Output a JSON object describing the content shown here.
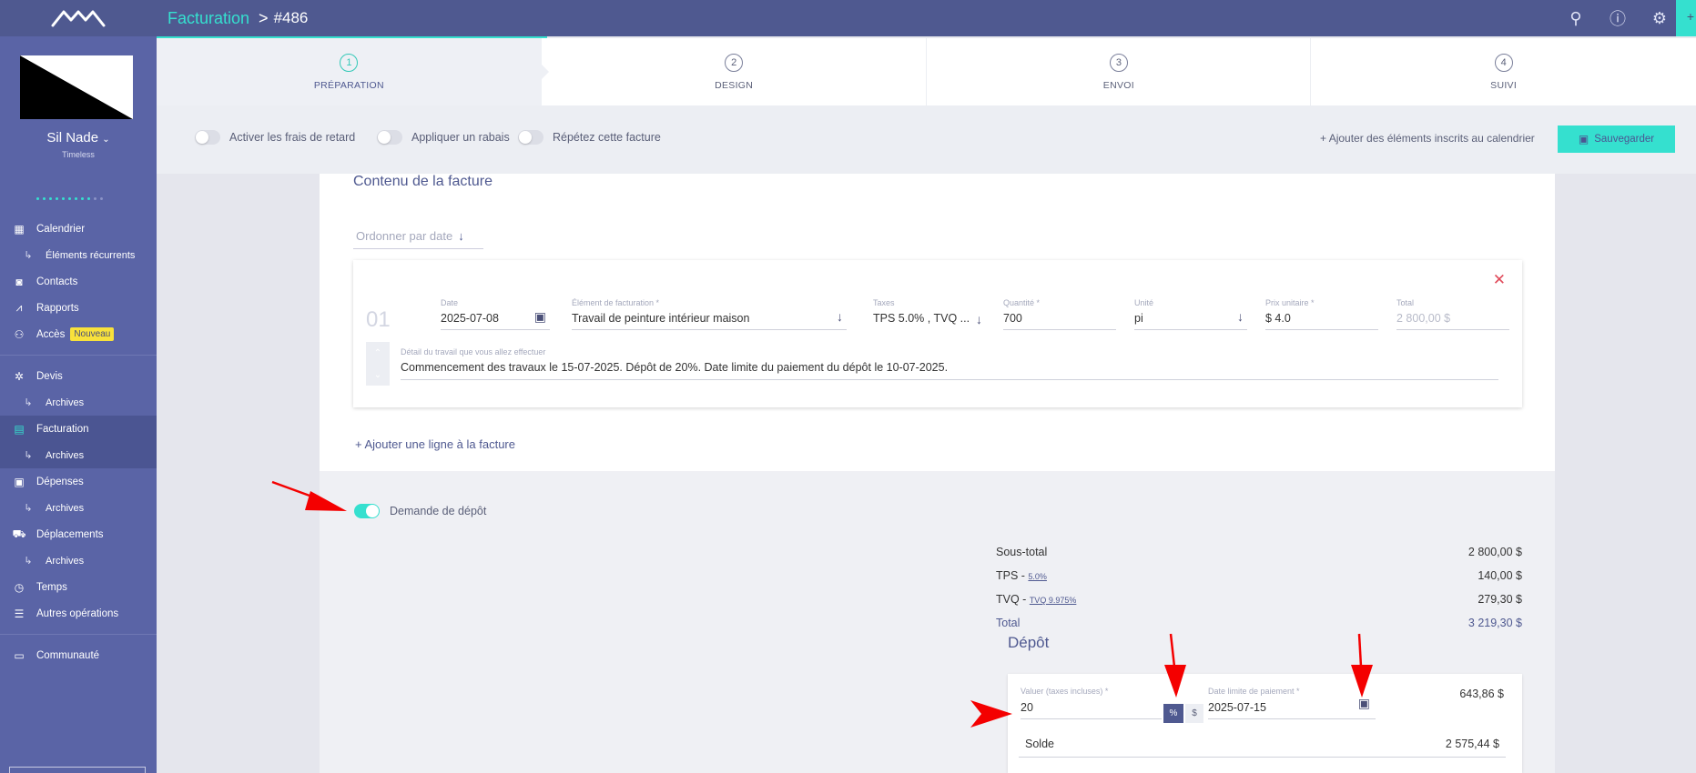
{
  "sidebar": {
    "user_name": "Sil Nade",
    "user_org": "Timeless",
    "items": [
      {
        "label": "Calendrier"
      },
      {
        "label": "Éléments récurrents"
      },
      {
        "label": "Contacts"
      },
      {
        "label": "Rapports"
      },
      {
        "label": "Accès",
        "badge": "Nouveau"
      },
      {
        "label": "Devis"
      },
      {
        "label": "Archives"
      },
      {
        "label": "Facturation"
      },
      {
        "label": "Archives"
      },
      {
        "label": "Dépenses"
      },
      {
        "label": "Archives"
      },
      {
        "label": "Déplacements"
      },
      {
        "label": "Archives"
      },
      {
        "label": "Temps"
      },
      {
        "label": "Autres opérations"
      },
      {
        "label": "Communauté"
      }
    ]
  },
  "header": {
    "section": "Facturation",
    "separator": ">",
    "invoice": "#486"
  },
  "steps": [
    {
      "num": "1",
      "label": "PRÉPARATION"
    },
    {
      "num": "2",
      "label": "DESIGN"
    },
    {
      "num": "3",
      "label": "ENVOI"
    },
    {
      "num": "4",
      "label": "SUIVI"
    }
  ],
  "options": {
    "late_fees": "Activer les frais de retard",
    "discount": "Appliquer un rabais",
    "repeat": "Répétez cette facture",
    "add_calendar": "Ajouter des éléments inscrits au calendrier",
    "save": "Sauvegarder"
  },
  "content": {
    "title": "Contenu de la facture",
    "sort_label": "Ordonner par date",
    "line": {
      "number": "01",
      "date_label": "Date",
      "date": "2025-07-08",
      "item_label": "Élément de facturation *",
      "item": "Travail de peinture intérieur maison",
      "taxes_label": "Taxes",
      "taxes": "TPS 5.0% , TVQ ...",
      "qty_label": "Quantité *",
      "qty": "700",
      "unit_label": "Unité",
      "unit": "pi",
      "price_label": "Prix unitaire *",
      "price": "$ 4.0",
      "total_label": "Total",
      "total": "2 800,00 $",
      "detail_label": "Détail du travail que vous allez effectuer",
      "detail": "Commencement des travaux le 15-07-2025. Dépôt de 20%. Date limite du paiement du dépôt le 10-07-2025."
    },
    "add_line": "Ajouter une ligne à la facture"
  },
  "deposit": {
    "toggle_label": "Demande de dépôt",
    "title": "Dépôt",
    "value_label": "Valuer (taxes incluses) *",
    "value": "20",
    "percent": "%",
    "dollar": "$",
    "due_label": "Date limite de paiement *",
    "due": "2025-07-15",
    "amount": "643,86 $",
    "balance_label": "Solde",
    "balance": "2 575,44 $"
  },
  "totals": {
    "subtotal_label": "Sous-total",
    "subtotal": "2 800,00 $",
    "tps_label": "TPS - ",
    "tps_rate": "5.0%",
    "tps": "140,00 $",
    "tvq_label": "TVQ - ",
    "tvq_rate": "TVQ 9.975%",
    "tvq": "279,30 $",
    "total_label": "Total",
    "total": "3 219,30 $"
  },
  "colors": {
    "sidebar": "#5a64a6",
    "topbar": "#4f5990",
    "accent": "#35e0cf",
    "annotation": "#f40000"
  }
}
